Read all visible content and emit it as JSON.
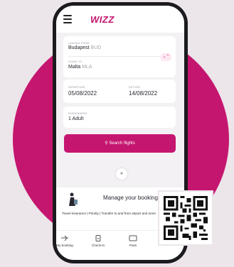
{
  "app": {
    "logo_text": "WIZZ"
  },
  "route": {
    "from_label": "LEAVING FROM",
    "from_city": "Budapest",
    "from_code": "BUD",
    "to_label": "GOING TO",
    "to_city": "Malta",
    "to_code": "MLA"
  },
  "dates": {
    "departure_label": "DEPARTURE",
    "departure_value": "05/08/2022",
    "return_label": "RETURN",
    "return_value": "14/08/2022"
  },
  "passengers": {
    "label": "PASSENGERS",
    "value": "1 Adult"
  },
  "search": {
    "label": "Search flights"
  },
  "manage": {
    "title": "Manage your booking",
    "description": "Travel insurance | Priority | Transfer to and from airport and more"
  },
  "bottom_nav": {
    "items": [
      {
        "label": "My booking",
        "icon": "plane-icon"
      },
      {
        "label": "Check-in",
        "icon": "boarding-pass-icon"
      },
      {
        "label": "Pass",
        "icon": "card-icon"
      }
    ]
  },
  "colors": {
    "brand": "#c5166f",
    "background": "#ece5ea"
  }
}
